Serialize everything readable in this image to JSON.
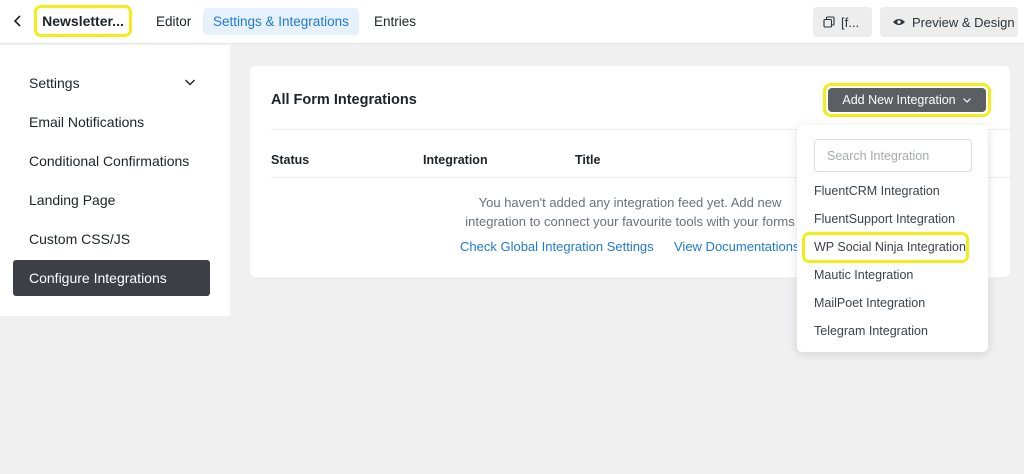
{
  "topbar": {
    "form_title": "Newsletter...",
    "tabs": [
      {
        "label": "Editor"
      },
      {
        "label": "Settings & Integrations"
      },
      {
        "label": "Entries"
      }
    ],
    "active_tab": "Settings & Integrations",
    "shortcode_label": "[f...",
    "preview_label": "Preview & Design"
  },
  "sidebar": {
    "items": [
      {
        "label": "Settings"
      },
      {
        "label": "Email Notifications"
      },
      {
        "label": "Conditional Confirmations"
      },
      {
        "label": "Landing Page"
      },
      {
        "label": "Custom CSS/JS"
      },
      {
        "label": "Configure Integrations"
      }
    ],
    "active_item": "Configure Integrations"
  },
  "main": {
    "title": "All Form Integrations",
    "add_button_label": "Add New Integration",
    "table_headers": [
      "Status",
      "Integration",
      "Title"
    ],
    "empty_message": "You haven't added any integration feed yet. Add new integration to connect your favourite tools with your forms",
    "links": [
      "Check Global Integration Settings",
      "View Documentations"
    ]
  },
  "dropdown": {
    "search_placeholder": "Search Integration",
    "items": [
      {
        "label": "FluentCRM Integration"
      },
      {
        "label": "FluentSupport Integration"
      },
      {
        "label": "WP Social Ninja Integration"
      },
      {
        "label": "Mautic Integration"
      },
      {
        "label": "MailPoet Integration"
      },
      {
        "label": "Telegram Integration"
      }
    ],
    "highlighted_item": "WP Social Ninja Integration"
  },
  "colors": {
    "accent": "#1e7ad5",
    "highlight": "#f1ed1a",
    "active_sidebar": "#3c3f46",
    "button_dark": "#5b5e63"
  },
  "icons": [
    "chevron-left-icon",
    "copy-icon",
    "eye-icon",
    "chevron-down-icon"
  ]
}
